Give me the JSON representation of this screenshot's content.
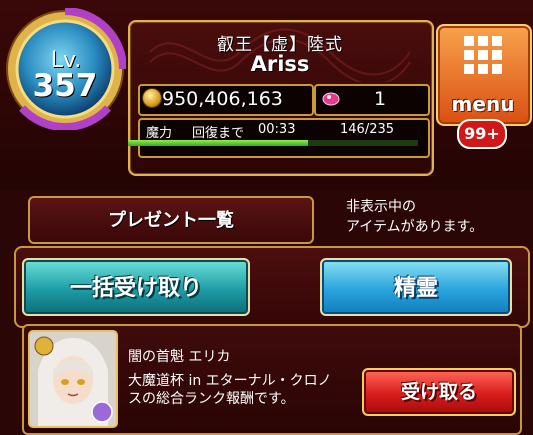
{
  "header": {
    "player_title": "叡王【虚】陸式",
    "player_name": "Ariss",
    "level_label": "Lv.",
    "level_value": "357",
    "coins": "950,406,163",
    "gems": "1",
    "mana_label": "魔力",
    "recovery_label": "回復まで",
    "recovery_time": "00:33",
    "mana_value": "146/235",
    "mana_fraction": 0.621,
    "menu_label": "menu",
    "badge": "99+"
  },
  "present": {
    "title": "プレゼント一覧",
    "hidden_notice_line1": "非表示中の",
    "hidden_notice_line2": "アイテムがあります。",
    "bulk_receive_label": "一括受け取り",
    "spirit_label": "精霊"
  },
  "item": {
    "name": "闇の首魁 エリカ",
    "description_line1": "大魔道杯 in エターナル・クロノ",
    "description_line2": "スの総合ランク報酬です。",
    "receive_label": "受け取る"
  },
  "icons": [
    "coin-icon",
    "gem-icon",
    "menu-grid-icon",
    "level-orb-icon",
    "character-portrait"
  ],
  "colors": {
    "accent_gold": "#d8a948",
    "bulk_button": "#1e9ca6",
    "spirit_button": "#2aa4dc",
    "receive_button": "#d81c1c",
    "menu_button": "#e8702a",
    "mana_bar": "#6bd43a"
  }
}
